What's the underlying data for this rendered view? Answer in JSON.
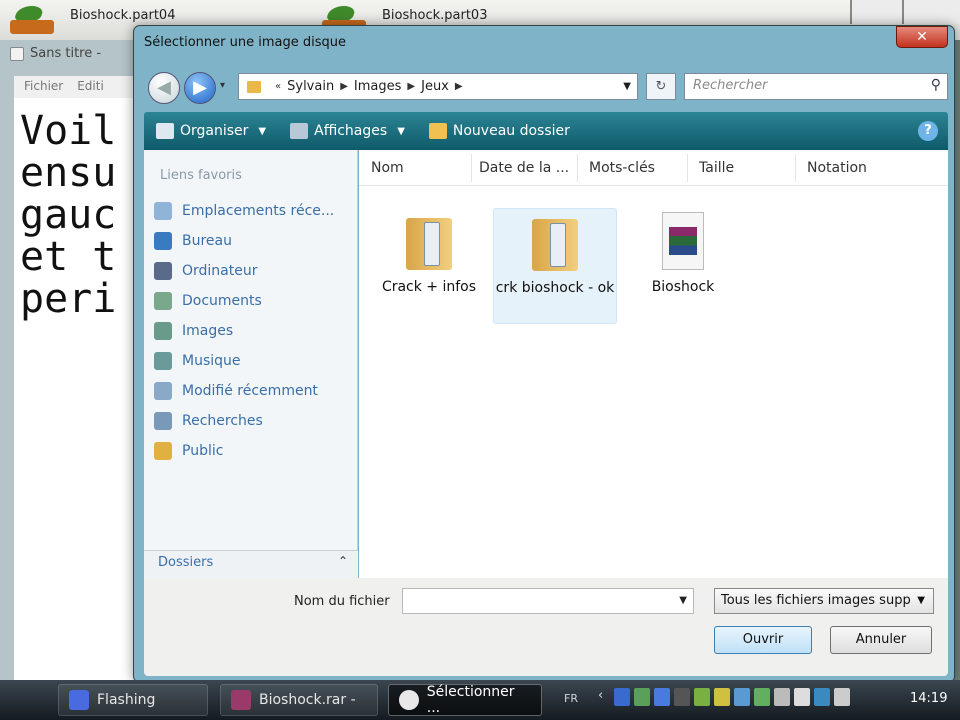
{
  "desktop": {
    "files": [
      "Bioshock.part04",
      "Bioshock.part03"
    ]
  },
  "notepad": {
    "title": "Sans titre - ",
    "menu": [
      "Fichier",
      "Editi"
    ],
    "text": "Voil\nensu\ngauc\net t\nperi"
  },
  "dialog": {
    "title": "Sélectionner une image disque",
    "close_icon": "close-icon",
    "breadcrumb": [
      "Sylvain",
      "Images",
      "Jeux"
    ],
    "search_placeholder": "Rechercher",
    "toolbar": {
      "organize": "Organiser",
      "views": "Affichages",
      "new_folder": "Nouveau dossier"
    },
    "sidebar": {
      "header": "Liens favoris",
      "items": [
        {
          "label": "Emplacements réce...",
          "icon": "recent-places-icon"
        },
        {
          "label": "Bureau",
          "icon": "desktop-icon"
        },
        {
          "label": "Ordinateur",
          "icon": "computer-icon"
        },
        {
          "label": "Documents",
          "icon": "documents-icon"
        },
        {
          "label": "Images",
          "icon": "pictures-icon"
        },
        {
          "label": "Musique",
          "icon": "music-icon"
        },
        {
          "label": "Modifié récemment",
          "icon": "recently-changed-icon"
        },
        {
          "label": "Recherches",
          "icon": "searches-icon"
        },
        {
          "label": "Public",
          "icon": "public-folder-icon"
        }
      ],
      "folders": "Dossiers"
    },
    "columns": [
      "Nom",
      "Date de la ...",
      "Mots-clés",
      "Taille",
      "Notation"
    ],
    "files": [
      {
        "name": "Crack + infos",
        "type": "folder"
      },
      {
        "name": "crk bioshock - ok",
        "type": "folder"
      },
      {
        "name": "Bioshock",
        "type": "archive"
      }
    ],
    "filename_label": "Nom du fichier",
    "filename_value": "",
    "filetype": "Tous les fichiers images supp",
    "open": "Ouvrir",
    "cancel": "Annuler"
  },
  "taskbar": {
    "tasks": [
      "Flashing",
      "Bioshock.rar -",
      "Sélectionner ..."
    ],
    "lang": "FR",
    "clock": "14:19"
  }
}
